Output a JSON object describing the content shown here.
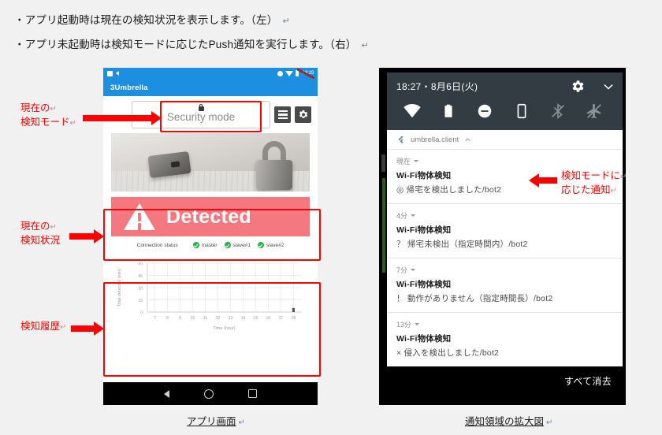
{
  "document": {
    "notes": [
      "・アプリ起動時は現在の検知状況を表示します。（左）",
      "・アプリ未起動時は検知モードに応じたPush通知を実行します。（右）"
    ],
    "captions": {
      "left": "アプリ画面",
      "right": "通知領域の拡大図"
    },
    "annotations": [
      {
        "id": "current-mode",
        "line1": "現在の",
        "line2": "検知モード"
      },
      {
        "id": "current-status",
        "line1": "現在の",
        "line2": "検知状況"
      },
      {
        "id": "detection-history",
        "line1": "検知履歴",
        "line2": ""
      },
      {
        "id": "mode-based-notification",
        "line1": "検知モードに",
        "line2": "応じた通知"
      }
    ],
    "annotation_color": "#ff0000"
  },
  "phone_app": {
    "status_bar": {
      "time": "18:29",
      "icons": [
        "save-icon",
        "share-icon",
        "gps-icon",
        "wifi-icon",
        "battery-icon"
      ]
    },
    "app_bar": {
      "title": "3Umbrella",
      "color": "#1d8fe0"
    },
    "mode_selector": {
      "lock_icon": "lock-icon",
      "value": "Security mode"
    },
    "toolbar_buttons": [
      {
        "name": "menu-button",
        "icon": "hamburger-icon"
      },
      {
        "name": "settings-button",
        "icon": "gear-icon"
      }
    ],
    "hero_image": {
      "alt": "padlock-and-usb-photo"
    },
    "detection_banner": {
      "icon": "warning-triangle-icon",
      "label": "Detected",
      "color": "#f4787f"
    },
    "connection_status": {
      "label": "Connection status",
      "devices": [
        "master",
        "slave#1",
        "slave#2"
      ]
    },
    "navigation_bar": {
      "buttons": [
        "back-button",
        "home-button",
        "recents-button"
      ]
    }
  },
  "chart_data": {
    "type": "bar",
    "title": "",
    "xlabel": "Time (hour)",
    "ylabel": "Total detected (min)",
    "categories": [
      7,
      8,
      9,
      10,
      11,
      12,
      13,
      14,
      15,
      16,
      17,
      18
    ],
    "values": [
      0,
      0,
      0,
      0,
      0,
      0,
      0,
      0,
      0,
      0,
      0,
      5
    ],
    "yticks": [
      0,
      15,
      30,
      45,
      60
    ],
    "ylim": [
      0,
      60
    ],
    "xlim": [
      6.4,
      18.6
    ],
    "grid": true,
    "legend": "none",
    "bar_color": "#555555"
  },
  "notification_panel": {
    "header": {
      "clock": "18:27",
      "separator": "・",
      "date": "8月6日(火)",
      "settings_icon": "gear-icon",
      "expand_icon": "chevron-down-icon"
    },
    "quick_settings": [
      {
        "name": "wifi-tile",
        "icon": "wifi-icon",
        "enabled": true
      },
      {
        "name": "battery-tile",
        "icon": "battery-icon",
        "enabled": true
      },
      {
        "name": "do-not-disturb-tile",
        "icon": "do-not-disturb-icon",
        "enabled": true
      },
      {
        "name": "device-tile",
        "icon": "phone-icon",
        "enabled": true
      },
      {
        "name": "bluetooth-tile",
        "icon": "bluetooth-off-icon",
        "enabled": false
      },
      {
        "name": "airplane-mode-tile",
        "icon": "airplane-off-icon",
        "enabled": false
      }
    ],
    "app_group": {
      "icon": "flutter-icon",
      "name": "umbrella.client",
      "collapse_icon": "chevron-up-icon"
    },
    "notifications": [
      {
        "time": "現在",
        "title": "Wi-Fi物体検知",
        "body": "◎ 帰宅を検出しました/bot2"
      },
      {
        "time": "4分",
        "title": "Wi-Fi物体検知",
        "body": "？ 帰宅未検出（指定時間内）/bot2"
      },
      {
        "time": "7分",
        "title": "Wi-Fi物体検知",
        "body": "！ 動作がありません（指定時間長）/bot2"
      },
      {
        "time": "13分",
        "title": "Wi-Fi物体検知",
        "body": "× 侵入を検出しました/bot2"
      }
    ],
    "clear_all_label": "すべて消去"
  }
}
